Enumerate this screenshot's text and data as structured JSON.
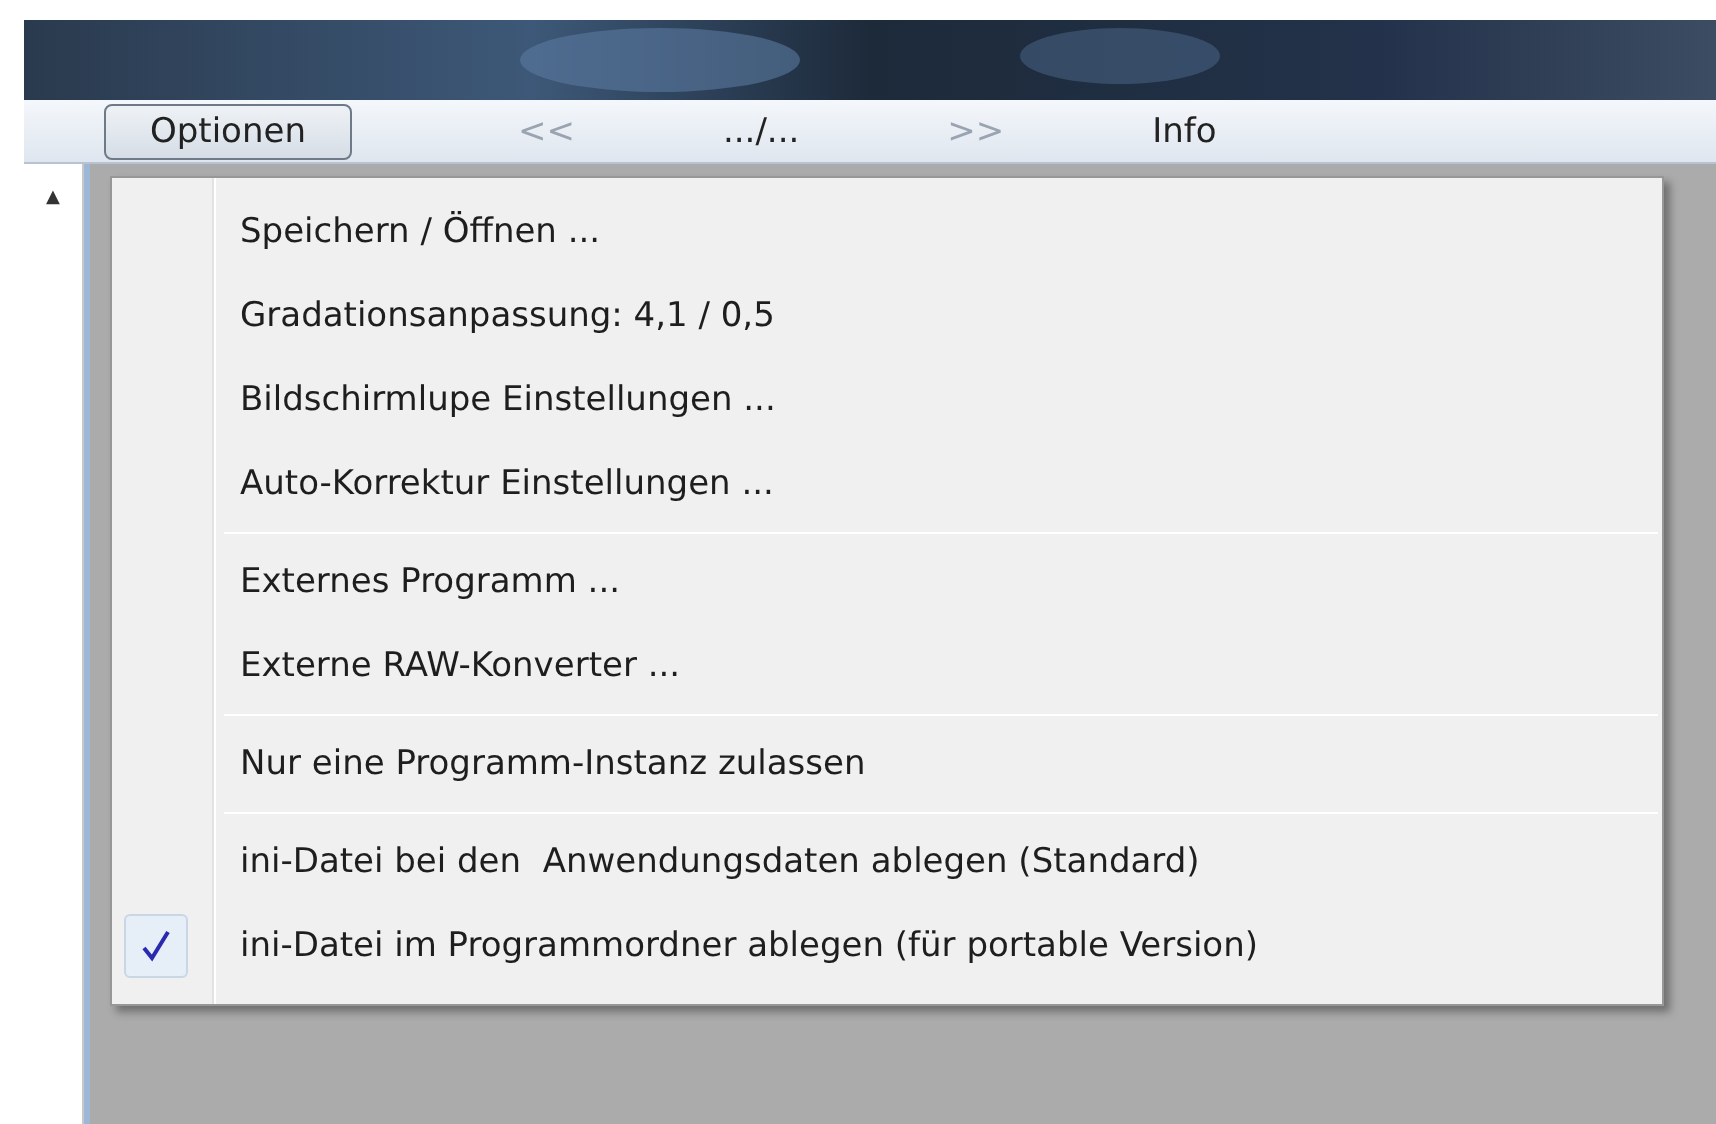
{
  "menu_bar": [
    {
      "label": "Optionen",
      "selected": true,
      "disabled": false
    },
    {
      "label": "<<",
      "selected": false,
      "disabled": true
    },
    {
      "label": ".../...",
      "selected": false,
      "disabled": false
    },
    {
      "label": ">>",
      "selected": false,
      "disabled": true
    },
    {
      "label": "Info",
      "selected": false,
      "disabled": false
    }
  ],
  "scrollbar": {
    "up_arrow": "▲"
  },
  "dropdown": {
    "groups": [
      [
        {
          "label": "Speichern / Öffnen ...",
          "checked": false
        },
        {
          "label": "Gradationsanpassung: 4,1 / 0,5",
          "checked": false
        },
        {
          "label": "Bildschirmlupe Einstellungen ...",
          "checked": false
        },
        {
          "label": "Auto-Korrektur Einstellungen ...",
          "checked": false
        }
      ],
      [
        {
          "label": "Externes Programm ...",
          "checked": false
        },
        {
          "label": "Externe RAW-Konverter ...",
          "checked": false
        }
      ],
      [
        {
          "label": "Nur eine Programm-Instanz zulassen",
          "checked": false
        }
      ],
      [
        {
          "label": "ini-Datei bei den  Anwendungsdaten ablegen (Standard)",
          "checked": false
        },
        {
          "label": "ini-Datei im Programmordner ablegen (für portable Version)",
          "checked": true
        }
      ]
    ]
  }
}
